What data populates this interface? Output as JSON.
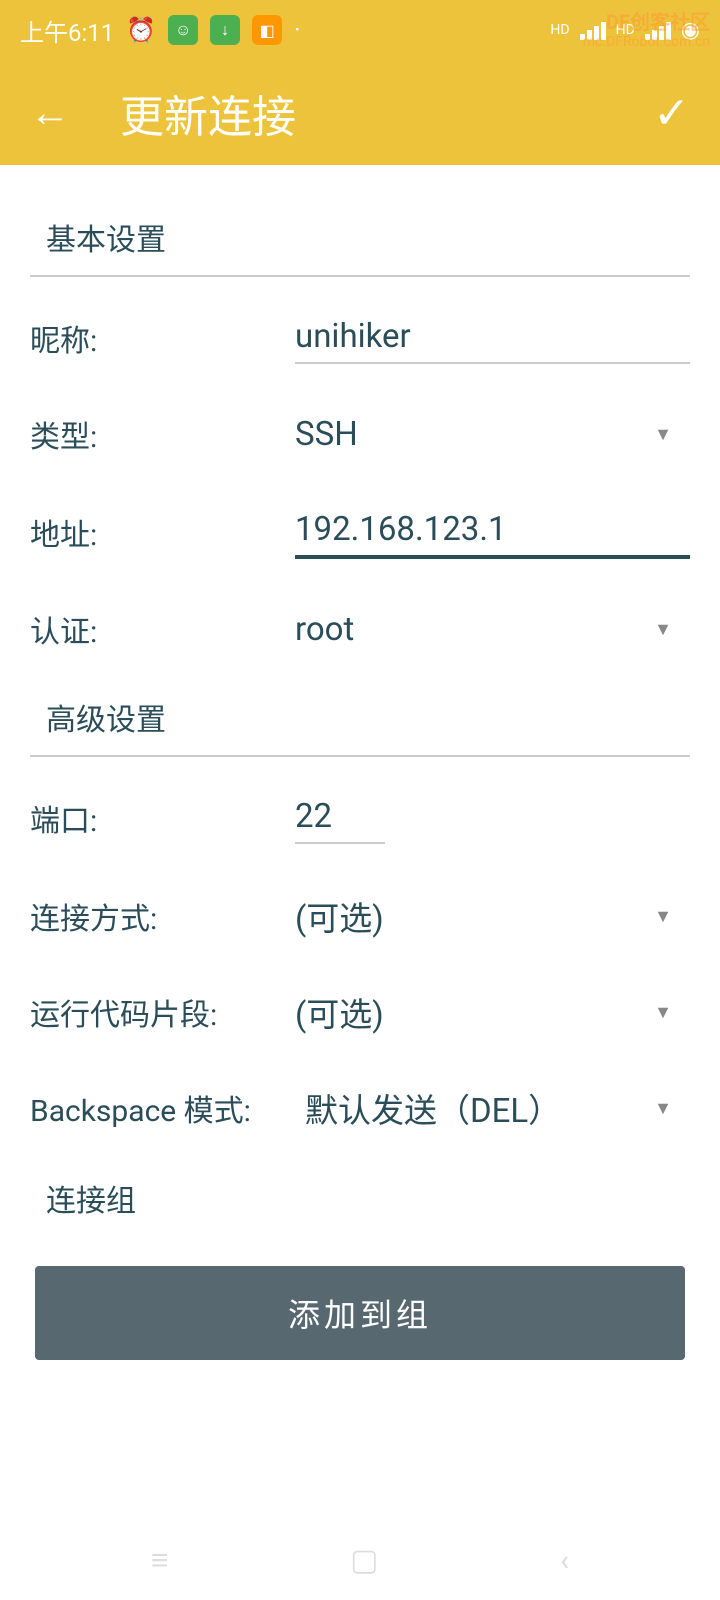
{
  "status_bar": {
    "time": "上午6:11",
    "signal_label_1": "HD",
    "signal_label_2": "HD"
  },
  "watermark": {
    "title": "DF创客社区",
    "url": "mc.DFRobot.com.cn"
  },
  "header": {
    "title": "更新连接"
  },
  "sections": {
    "basic": "基本设置",
    "advanced": "高级设置",
    "group": "连接组"
  },
  "form": {
    "nickname_label": "昵称:",
    "nickname_value": "unihiker",
    "type_label": "类型:",
    "type_value": "SSH",
    "address_label": "地址:",
    "address_value": "192.168.123.1",
    "auth_label": "认证:",
    "auth_value": "root",
    "port_label": "端口:",
    "port_value": "22",
    "connection_mode_label": "连接方式:",
    "connection_mode_value": "(可选)",
    "snippet_label": "运行代码片段:",
    "snippet_value": "(可选)",
    "backspace_label": "Backspace 模式:",
    "backspace_value": "默认发送（DEL）"
  },
  "button": {
    "add_to_group": "添加到组"
  }
}
